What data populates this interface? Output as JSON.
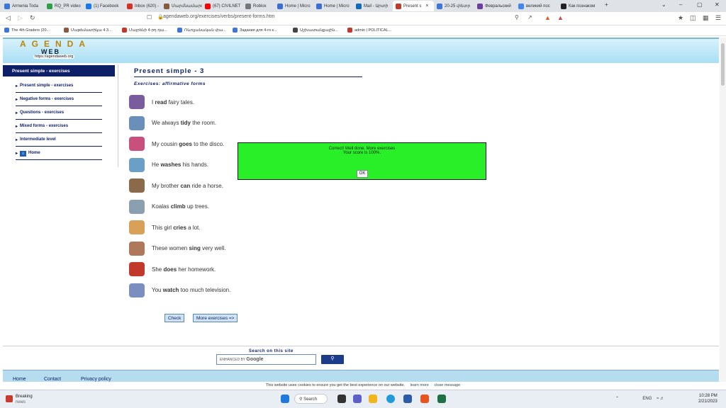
{
  "browser": {
    "tabs": [
      {
        "label": "Armenia Toda",
        "color": "#3c77d8"
      },
      {
        "label": "RQ_PR video",
        "color": "#2e9e4a"
      },
      {
        "label": "(1) Facebook",
        "color": "#1877f2"
      },
      {
        "label": "Inbox (620) -",
        "color": "#d93025"
      },
      {
        "label": "Մարմնամարզ",
        "color": "#8a5a3c"
      },
      {
        "label": "(67) CIVILNET",
        "color": "#ff0000"
      },
      {
        "label": "Roblox",
        "color": "#777777"
      },
      {
        "label": "Home | Micro",
        "color": "#3b6fd6"
      },
      {
        "label": "Home | Micro",
        "color": "#3b6fd6"
      },
      {
        "label": "Mail - Արտի",
        "color": "#0f6cbd"
      },
      {
        "label": "Present s",
        "color": "#c0392b"
      },
      {
        "label": "20-25 փետր",
        "color": "#3c77d8"
      },
      {
        "label": "Февральский",
        "color": "#6b3fa0"
      },
      {
        "label": "великий пос",
        "color": "#4285f4"
      },
      {
        "label": "Как познаком",
        "color": "#222222"
      }
    ],
    "new_tab": "+",
    "url": "agendaweb.org/exercises/verbs/present-forms.htm",
    "bookmarks": [
      {
        "label": "The 4th Graders (20...",
        "color": "#3c77d8"
      },
      {
        "label": "Մաթեմատիկա 4.3...",
        "color": "#8a5a3c"
      },
      {
        "label": "Մայրենի 4-րդ դա...",
        "color": "#c0392b"
      },
      {
        "label": "Ռևոլյանական փա...",
        "color": "#3c77d8"
      },
      {
        "label": "Задания для 4-го к...",
        "color": "#3c77d8"
      },
      {
        "label": "Աշխատանքային...",
        "color": "#444444"
      },
      {
        "label": "admin | POLITICAL...",
        "color": "#c0392b"
      }
    ]
  },
  "site": {
    "logo_text": "AGENDA",
    "logo_sub": "WEB",
    "logo_url": "https://agendaweb.org"
  },
  "sidebar": {
    "heading": "Present simple - exercises",
    "items": [
      {
        "label": "Present simple - exercises"
      },
      {
        "label": "Negative forms - exercises"
      },
      {
        "label": "Questions - exercises"
      },
      {
        "label": "Mixed forms - exercises"
      },
      {
        "label": "Intermediate level"
      },
      {
        "label": "Home"
      }
    ]
  },
  "main": {
    "title": "Present simple - 3",
    "subtitle": "Exercises: affirmative forms",
    "sentences": [
      {
        "pre": "I ",
        "verb": "read",
        "post": " fairy tales.",
        "color": "#7a5c9e"
      },
      {
        "pre": "We always ",
        "verb": "tidy",
        "post": " the room.",
        "color": "#6a8fb8"
      },
      {
        "pre": "My cousin ",
        "verb": "goes",
        "post": " to the disco.",
        "color": "#c94f7c"
      },
      {
        "pre": "He ",
        "verb": "washes",
        "post": " his hands.",
        "color": "#6aa0c8"
      },
      {
        "pre": "My brother ",
        "verb": "can",
        "post": " ride a horse.",
        "color": "#8a6a4a"
      },
      {
        "pre": "Koalas ",
        "verb": "climb",
        "post": " up trees.",
        "color": "#8aa0b0"
      },
      {
        "pre": "This girl ",
        "verb": "cries",
        "post": " a lot.",
        "color": "#d9a05a"
      },
      {
        "pre": "These women ",
        "verb": "sing",
        "post": " very well.",
        "color": "#b0785a"
      },
      {
        "pre": "She ",
        "verb": "does",
        "post": " her homework.",
        "color": "#c0392b"
      },
      {
        "pre": "You ",
        "verb": "watch",
        "post": " too much television.",
        "color": "#7a8fc0"
      }
    ],
    "check_button": "Check",
    "more_button": "More exercises =>"
  },
  "popup": {
    "line1": "Correct! Well done. More exercises",
    "line2": "Your score is 100%.",
    "ok": "OK"
  },
  "search": {
    "label": "Search on this site",
    "enhanced": "ENHANCED BY",
    "google": "Google",
    "button_icon": "search-icon"
  },
  "footer": {
    "links": [
      "Home",
      "Contact",
      "Privacy policy"
    ]
  },
  "cookie": {
    "text": "This website uses cookies to ensure you get the best experience on our website.",
    "learn": "learn more",
    "close": "close message"
  },
  "taskbar": {
    "weather_title": "Breaking",
    "weather_sub": "news",
    "weather_badge": "1",
    "search": "Search",
    "lang": "ENG",
    "time": "10:28 PM",
    "date": "2/21/2023"
  }
}
